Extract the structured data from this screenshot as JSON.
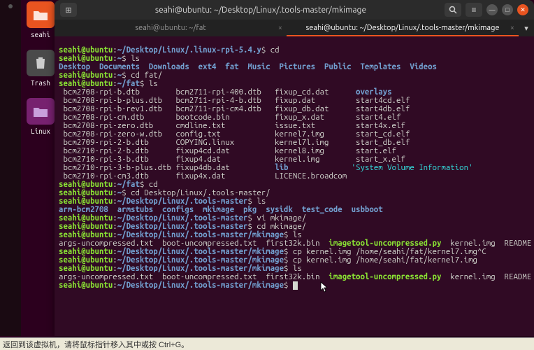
{
  "desktop": {
    "home_label": "seahi",
    "trash_label": "Trash",
    "linux_label": "Linux"
  },
  "window": {
    "title": "seahi@ubuntu: ~/Desktop/Linux/.tools-master/mkimage",
    "tabs": [
      {
        "label": "seahi@ubuntu: ~/fat",
        "active": false
      },
      {
        "label": "seahi@ubuntu: ~/Desktop/Linux/.tools-master/mkimage",
        "active": true
      }
    ]
  },
  "term": {
    "l1_user": "seahi@ubuntu",
    "l1_path": "~/Desktop/Linux/.linux-rpi-5.4.y",
    "l1_cmd": "cd",
    "l2_user": "seahi@ubuntu",
    "l2_path": "~",
    "l2_cmd": "ls",
    "l3_dirs": "Desktop  Documents  Downloads  ext4  fat  Music  Pictures  Public  Templates  Videos",
    "l4_user": "seahi@ubuntu",
    "l4_path": "~",
    "l4_cmd": "cd fat/",
    "l5_user": "seahi@ubuntu",
    "l5_path": "~/fat",
    "l5_cmd": "ls",
    "fat_c1": " bcm2708-rpi-b.dtb        bcm2711-rpi-400.dtb   fixup_cd.dat      ",
    "fat_c1b": "overlays",
    "fat_c2": " bcm2708-rpi-b-plus.dtb   bcm2711-rpi-4-b.dtb   fixup.dat         start4cd.elf",
    "fat_c3": " bcm2708-rpi-b-rev1.dtb   bcm2711-rpi-cm4.dtb   fixup_db.dat      start4db.elf",
    "fat_c4": " bcm2708-rpi-cm.dtb       bootcode.bin          fixup_x.dat       start4.elf",
    "fat_c5": " bcm2708-rpi-zero.dtb     cmdline.txt           issue.txt         start4x.elf",
    "fat_c6": " bcm2708-rpi-zero-w.dtb   config.txt            kernel7.img       start_cd.elf",
    "fat_c7": " bcm2709-rpi-2-b.dtb      COPYING.linux         kernel7l.img      start_db.elf",
    "fat_c8": " bcm2710-rpi-2-b.dtb      fixup4cd.dat          kernel8.img       start.elf",
    "fat_c9": " bcm2710-rpi-3-b.dtb      fixup4.dat            kernel.img        start_x.elf",
    "fat_c10a": " bcm2710-rpi-3-b-plus.dtb fixup4db.dat          ",
    "fat_c10b": "lib",
    "fat_c10c": "              ",
    "fat_c10d": "'System Volume Information'",
    "fat_c11": " bcm2710-rpi-cm3.dtb      fixup4x.dat           LICENCE.broadcom",
    "l6_user": "seahi@ubuntu",
    "l6_path": "~/fat",
    "l6_cmd": "cd",
    "l7_user": "seahi@ubuntu",
    "l7_path": "~",
    "l7_cmd": "cd Desktop/Linux/.tools-master/",
    "l8_user": "seahi@ubuntu",
    "l8_path": "~/Desktop/Linux/.tools-master",
    "l8_cmd": "ls",
    "tm_dirs": "arm-bcm2708  armstubs  configs  mkimage  pkg  sysidk  test_code  usbboot",
    "l9_user": "seahi@ubuntu",
    "l9_path": "~/Desktop/Linux/.tools-master",
    "l9_cmd": "vi mkimage/",
    "l10_user": "seahi@ubuntu",
    "l10_path": "~/Desktop/Linux/.tools-master",
    "l10_cmd": "cd mkimage/",
    "l11_user": "seahi@ubuntu",
    "l11_path": "~/Desktop/Linux/.tools-master/mkimage",
    "l11_cmd": "ls",
    "mk_a1": "args-uncompressed.txt  boot-uncompressed.txt  first32k.bin  ",
    "mk_a2": "imagetool-uncompressed.py",
    "mk_a3": "  kernel.img  README",
    "l12_user": "seahi@ubuntu",
    "l12_path": "~/Desktop/Linux/.tools-master/mkimage",
    "l12_cmd": "cp kernel.img /home/seahi/fat/kernel7.img^C",
    "l13_user": "seahi@ubuntu",
    "l13_path": "~/Desktop/Linux/.tools-master/mkimage",
    "l13_cmd": "cp kernel.img /home/seahi/fat/kernel7.img",
    "l14_user": "seahi@ubuntu",
    "l14_path": "~/Desktop/Linux/.tools-master/mkimage",
    "l14_cmd": "ls",
    "l15_user": "seahi@ubuntu",
    "l15_path": "~/Desktop/Linux/.tools-master/mkimage",
    "l15_cmd": ""
  },
  "statusbar": "返回到该虚拟机，请将鼠标指针移入其中或按 Ctrl+G。"
}
